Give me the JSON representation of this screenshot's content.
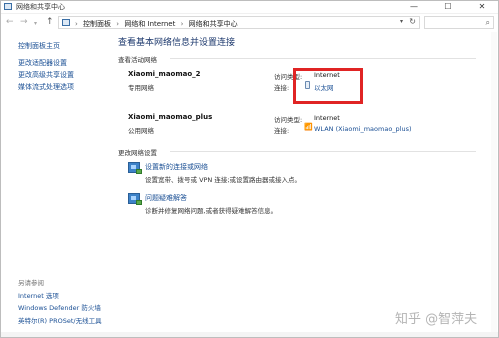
{
  "window": {
    "title": "网络和共享中心",
    "minimize_glyph": "—",
    "maximize_glyph": "☐",
    "close_glyph": "✕"
  },
  "nav": {
    "back_glyph": "←",
    "forward_glyph": "→",
    "recent_glyph": "▾",
    "up_glyph": "↑"
  },
  "address": {
    "breadcrumbs": [
      "控制面板",
      "网络和 Internet",
      "网络和共享中心"
    ],
    "separator": "›",
    "dropdown_glyph": "▾",
    "refresh_glyph": "↻",
    "search_glyph": "⌕"
  },
  "sidebar": {
    "items": [
      "控制面板主页",
      "更改适配器设置",
      "更改高级共享设置",
      "媒体流式处理选项"
    ],
    "see_also_label": "另请参阅",
    "see_also_items": [
      "Internet 选项",
      "Windows Defender 防火墙",
      "英特尔(R) PROSet/无线工具"
    ]
  },
  "main": {
    "title": "查看基本网络信息并设置连接",
    "active_networks_header": "查看活动网络",
    "networks": [
      {
        "name": "Xiaomi_maomao_2",
        "category": "专用网络",
        "access_type_label": "访问类型:",
        "access_type_value": "Internet",
        "connection_label": "连接:",
        "connection_value": "以太网",
        "connection_icon": "ethernet-icon"
      },
      {
        "name": "Xiaomi_maomao_plus",
        "category": "公用网络",
        "access_type_label": "访问类型:",
        "access_type_value": "Internet",
        "connection_label": "连接:",
        "connection_value": "WLAN (Xiaomi_maomao_plus)",
        "connection_icon": "wifi-signal-icon"
      }
    ],
    "change_settings_header": "更改网络设置",
    "tasks": [
      {
        "title": "设置新的连接或网络",
        "description": "设置宽带、拨号或 VPN 连接;或设置路由器或接入点。",
        "icon": "new-connection-icon"
      },
      {
        "title": "问题疑难解答",
        "description": "诊断并修复网络问题,或者获得疑难解答信息。",
        "icon": "troubleshoot-icon"
      }
    ]
  },
  "wifi_glyph": "📶",
  "watermark": "知乎 @智萍夫",
  "colors": {
    "link": "#1a4f94",
    "title": "#1e3a6e",
    "highlight": "#e02424"
  }
}
